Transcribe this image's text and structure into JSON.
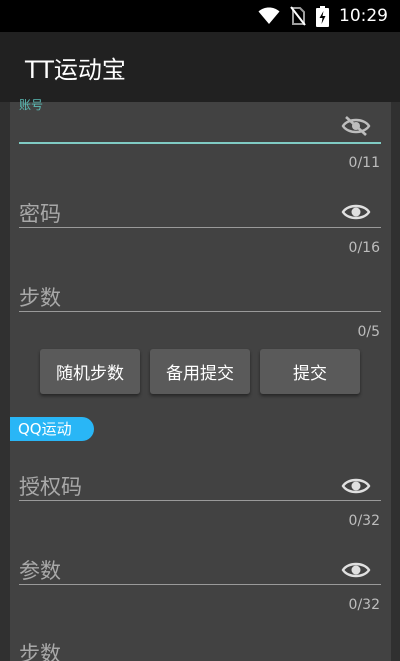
{
  "status_bar": {
    "time": "10:29"
  },
  "app_bar": {
    "title": "TT运动宝"
  },
  "form": {
    "account": {
      "label": "账号",
      "counter": "0/11"
    },
    "password": {
      "label": "密码",
      "counter": "0/16"
    },
    "steps": {
      "label": "步数",
      "counter": "0/5"
    },
    "buttons": {
      "random": "随机步数",
      "backup": "备用提交",
      "submit": "提交"
    }
  },
  "qq_section": {
    "tag": "QQ运动",
    "auth_code": {
      "label": "授权码",
      "counter": "0/32"
    },
    "params": {
      "label": "参数",
      "counter": "0/32"
    },
    "steps": {
      "label": "步数"
    }
  },
  "colors": {
    "accent_teal": "#80cbc4",
    "tag_blue": "#29b6f6",
    "card_bg": "#424242",
    "bg": "#303030"
  },
  "icons": [
    "wifi-icon",
    "no-sim-icon",
    "battery-charging-icon",
    "eye-off-icon",
    "eye-icon"
  ]
}
